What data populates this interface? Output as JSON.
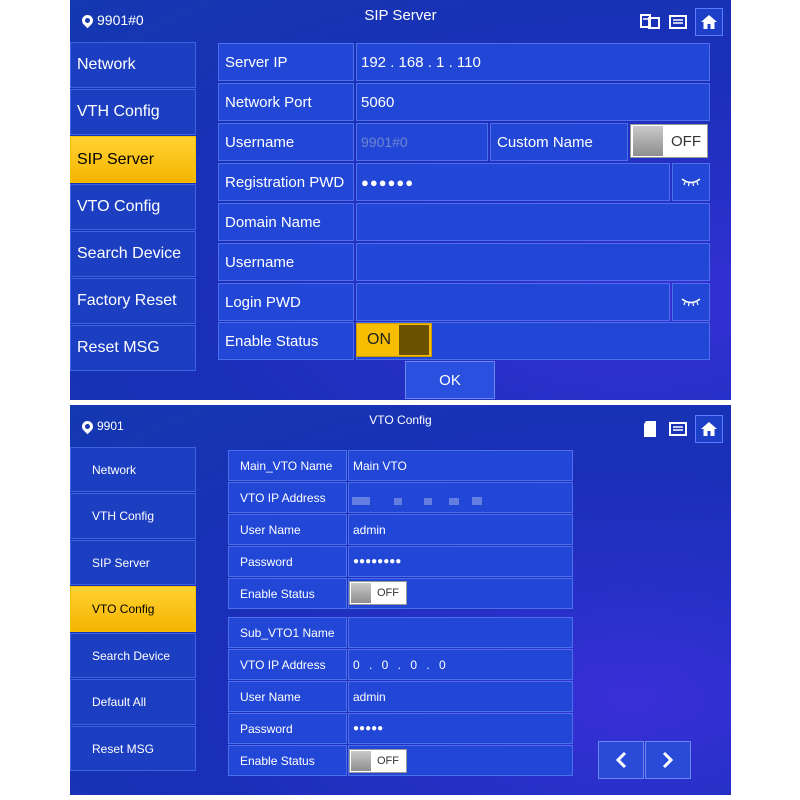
{
  "colors": {
    "accent": "#f5b400",
    "panel": "#2247d6",
    "background": "#1a2fb8"
  },
  "top": {
    "device": "9901#0",
    "title": "SIP Server",
    "menu": [
      "Network",
      "VTH Config",
      "SIP Server",
      "VTO Config",
      "Search Device",
      "Factory Reset",
      "Reset MSG"
    ],
    "rows": [
      {
        "label": "Server IP",
        "value": "192 . 168 . 1 . 110"
      },
      {
        "label": "Network Port",
        "value": "5060"
      },
      {
        "label": "Username",
        "value": "9901#0",
        "custom_label": "Custom Name",
        "custom_toggle": "OFF"
      },
      {
        "label": "Registration PWD",
        "value": "●●●●●●"
      },
      {
        "label": "Domain Name",
        "value": ""
      },
      {
        "label": "Username",
        "value": ""
      },
      {
        "label": "Login PWD",
        "value": ""
      },
      {
        "label": "Enable Status",
        "toggle": "ON"
      }
    ],
    "ok": "OK"
  },
  "bottom": {
    "device": "9901",
    "title": "VTO Config",
    "menu": [
      "Network",
      "VTH Config",
      "SIP Server",
      "VTO Config",
      "Search Device",
      "Default All",
      "Reset MSG"
    ],
    "rows": [
      {
        "label": "Main_VTO Name",
        "value": "Main VTO"
      },
      {
        "label": "VTO IP Address",
        "value": ""
      },
      {
        "label": "User Name",
        "value": "admin"
      },
      {
        "label": "Password",
        "value": "●●●●●●●●"
      },
      {
        "label": "Enable Status",
        "toggle": "OFF"
      },
      {
        "label": "Sub_VTO1 Name",
        "value": ""
      },
      {
        "label": "VTO IP Address",
        "value": "0 . 0 . 0 . 0"
      },
      {
        "label": "User Name",
        "value": "admin"
      },
      {
        "label": "Password",
        "value": "●●●●●"
      },
      {
        "label": "Enable Status",
        "toggle": "OFF"
      }
    ]
  }
}
